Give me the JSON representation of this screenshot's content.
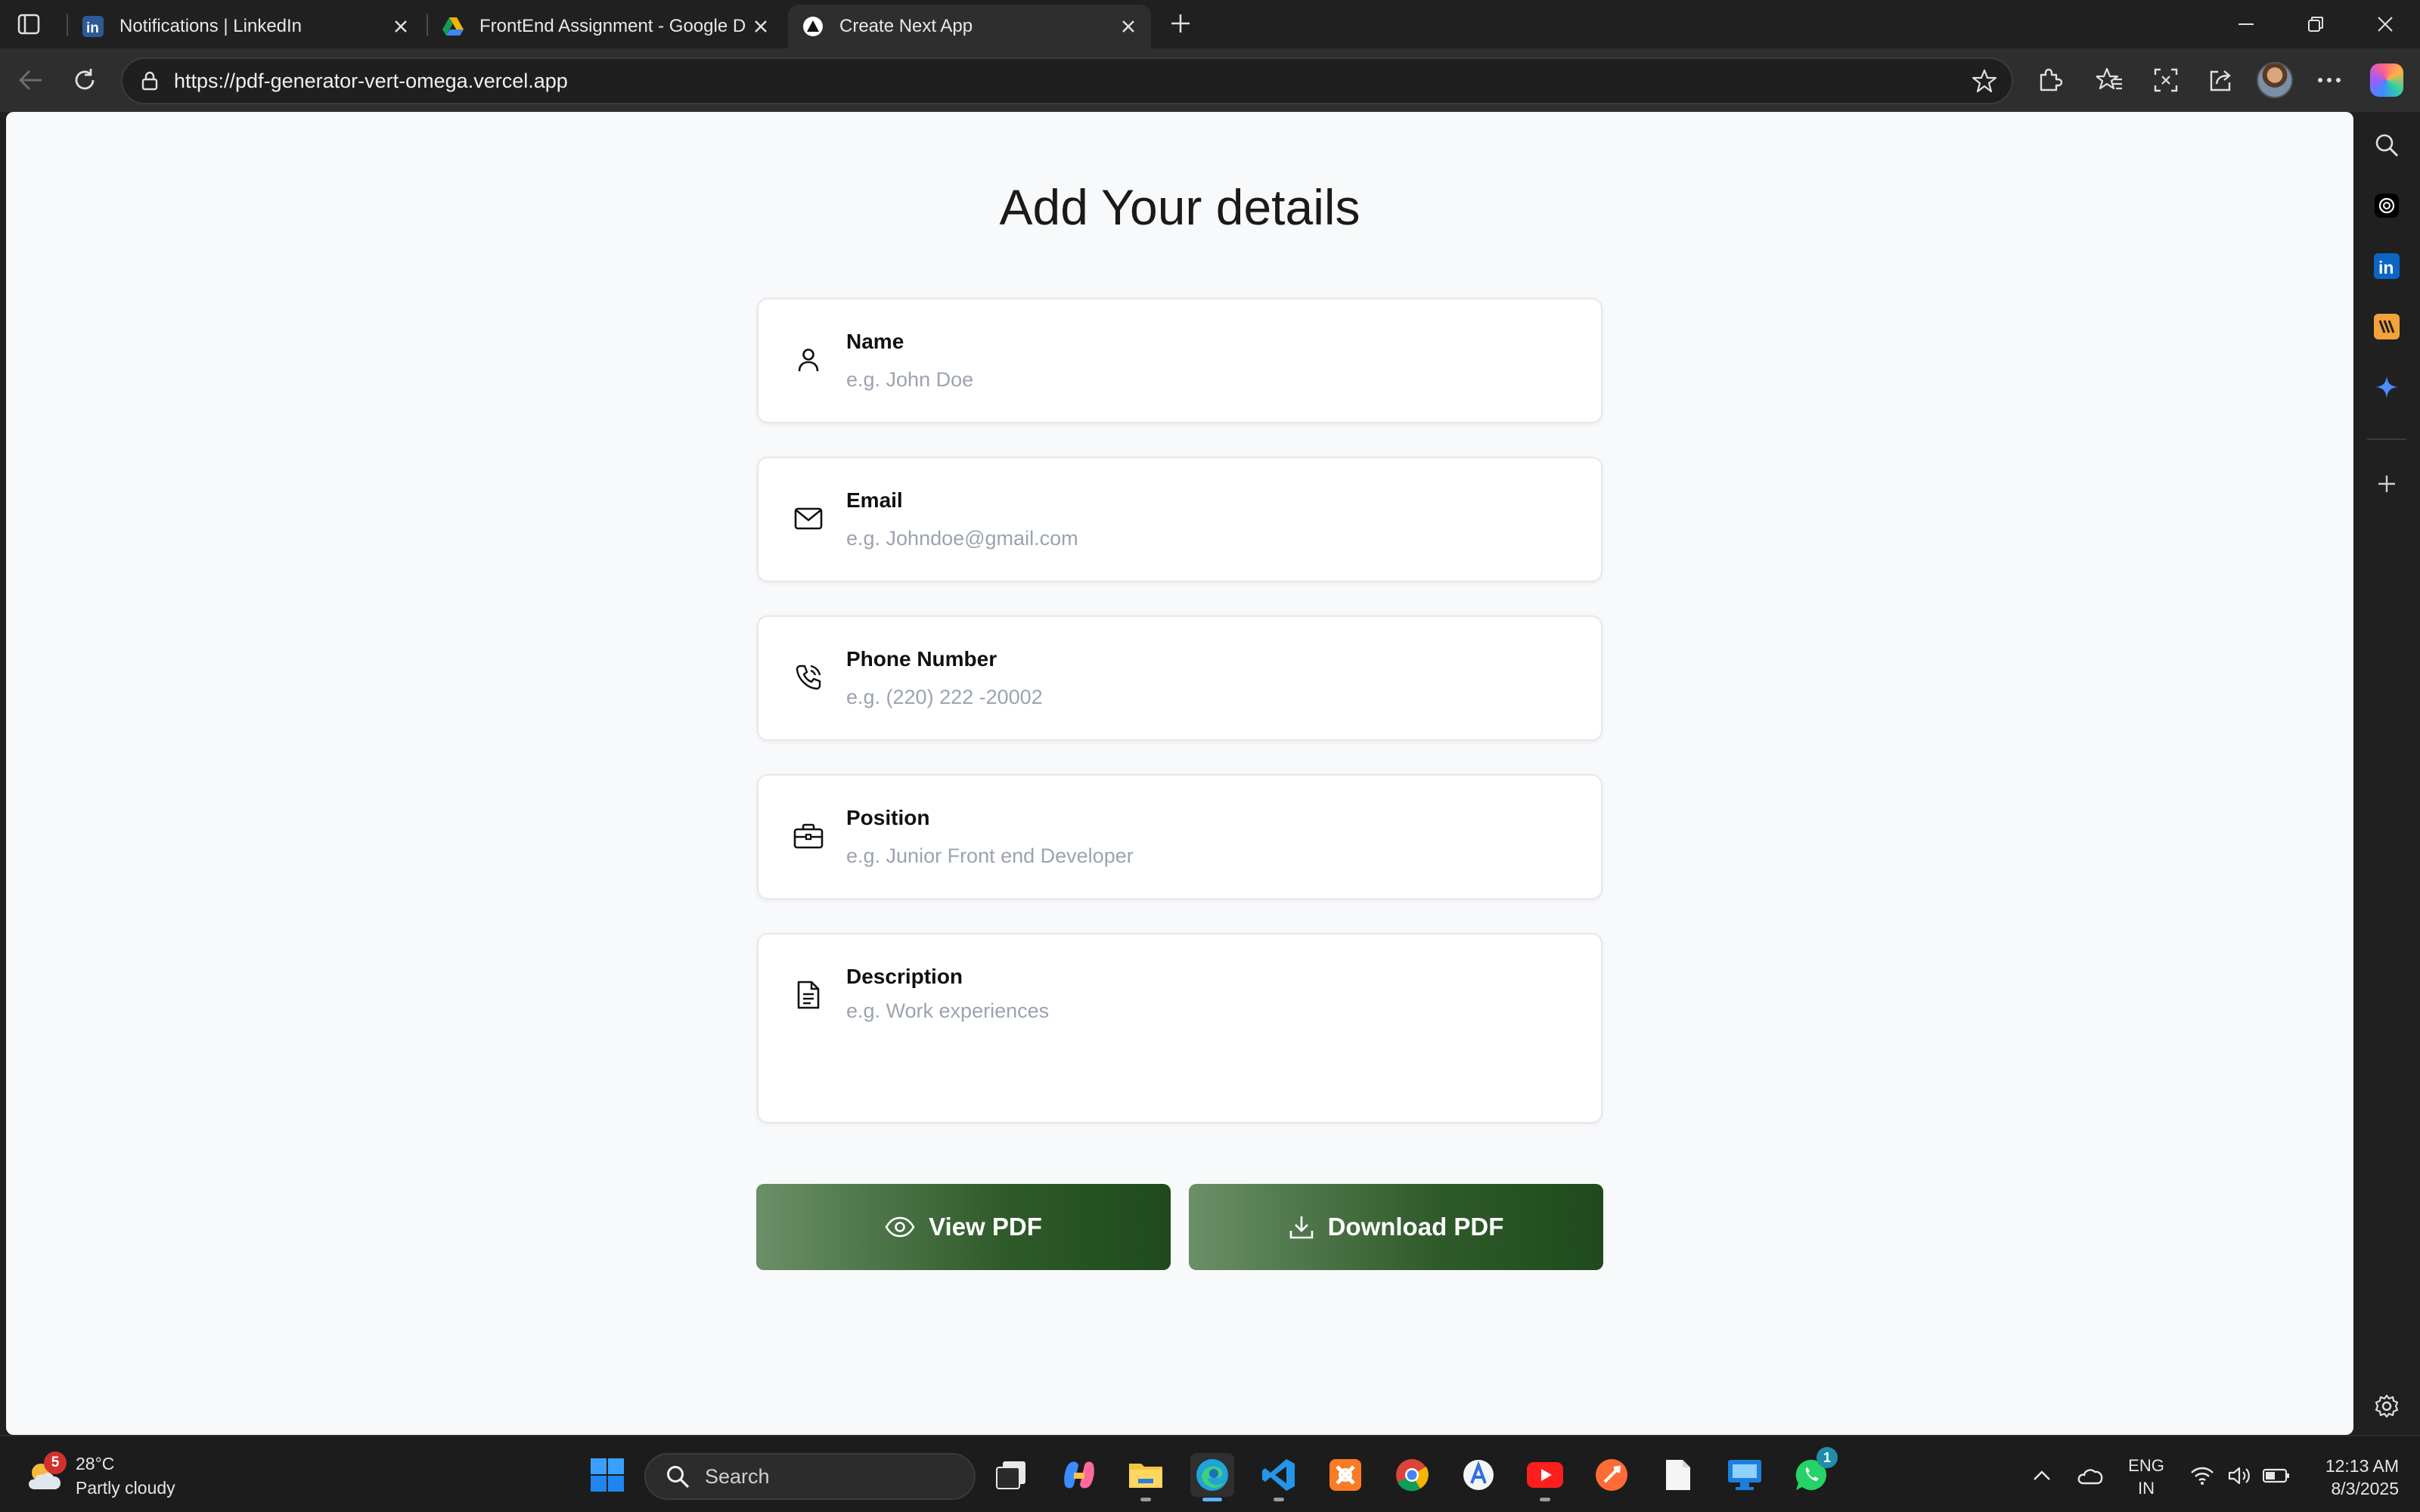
{
  "browser": {
    "tabs": [
      {
        "title": "Notifications | LinkedIn",
        "icon": "linkedin-icon",
        "active": false
      },
      {
        "title": "FrontEnd Assignment - Google Dr",
        "icon": "google-drive-icon",
        "active": false
      },
      {
        "title": "Create Next App",
        "icon": "nextjs-icon",
        "active": true
      }
    ],
    "url": "https://pdf-generator-vert-omega.vercel.app"
  },
  "page": {
    "title": "Add Your details",
    "fields": [
      {
        "label": "Name",
        "placeholder": "e.g. John Doe",
        "icon": "user-icon"
      },
      {
        "label": "Email",
        "placeholder": "e.g. Johndoe@gmail.com",
        "icon": "mail-icon"
      },
      {
        "label": "Phone Number",
        "placeholder": "e.g. (220) 222 -20002",
        "icon": "phone-icon"
      },
      {
        "label": "Position",
        "placeholder": "e.g. Junior Front end Developer",
        "icon": "briefcase-icon"
      },
      {
        "label": "Description",
        "placeholder": "e.g. Work experiences",
        "icon": "document-icon"
      }
    ],
    "buttons": {
      "view": "View PDF",
      "download": "Download PDF"
    },
    "colors": {
      "button_start": "#6b8f67",
      "button_end": "#1f4a1d",
      "background": "#f8f9fa"
    }
  },
  "taskbar": {
    "weather": {
      "badge": "5",
      "temp": "28°C",
      "condition": "Partly cloudy"
    },
    "search_label": "Search",
    "whatsapp_badge": "1",
    "lang_1": "ENG",
    "lang_2": "IN",
    "time": "12:13 AM",
    "date": "8/3/2025"
  }
}
